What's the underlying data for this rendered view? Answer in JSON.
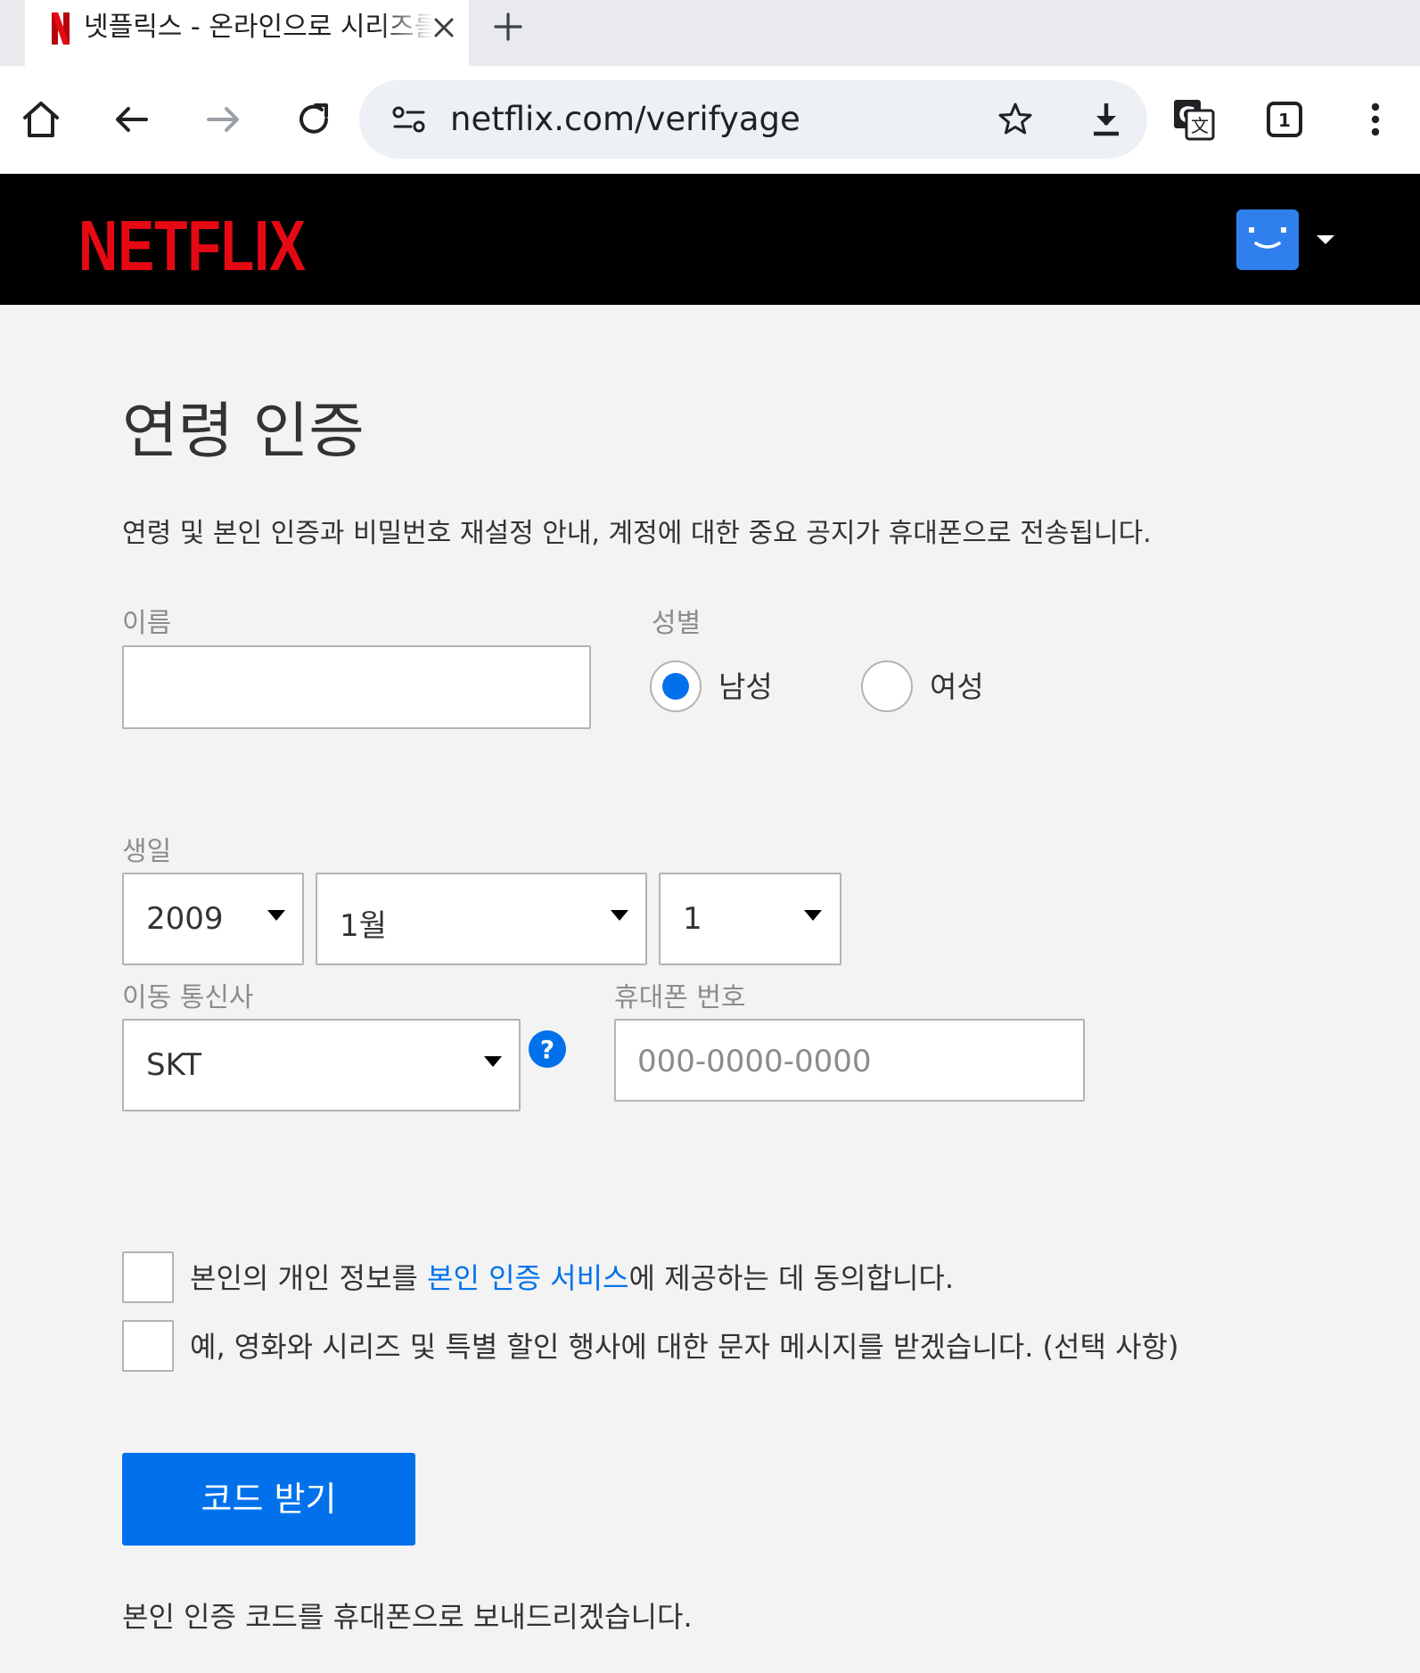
{
  "browser": {
    "tab": {
      "title": "넷플릭스 - 온라인으로 시리즈를 시청하세요",
      "close_icon": "close-icon",
      "favicon_color": "#e50914"
    },
    "new_tab_icon": "plus-icon",
    "toolbar": {
      "icons": [
        "home-icon",
        "back-arrow-icon",
        "forward-arrow-icon",
        "reload-icon",
        "translate-icon",
        "tab-count-icon",
        "more-vert-icon"
      ],
      "tab_count": "1"
    },
    "omnibox": {
      "url": "netflix.com/verifyage",
      "icons": [
        "site-settings-icon",
        "star-icon",
        "download-icon"
      ]
    }
  },
  "header": {
    "logo_text": "NETFLIX",
    "brand_color": "#e50914",
    "avatar_color": "#2f80ed"
  },
  "page": {
    "title": "연령 인증",
    "intro": "연령 및 본인 인증과 비밀번호 재설정 안내, 계정에 대한 중요 공지가 휴대폰으로 전송됩니다.",
    "name": {
      "label": "이름",
      "value": ""
    },
    "gender": {
      "label": "성별",
      "options": [
        {
          "label": "남성",
          "selected": true
        },
        {
          "label": "여성",
          "selected": false
        }
      ]
    },
    "birthday": {
      "label": "생일",
      "year": "2009",
      "month": "1월",
      "day": "1"
    },
    "carrier": {
      "label": "이동 통신사",
      "value": "SKT",
      "help_icon": "question-icon"
    },
    "phone": {
      "label": "휴대폰 번호",
      "placeholder": "000-0000-0000"
    },
    "consent": {
      "prefix": "본인의 개인 정보를 ",
      "link": "본인 인증 서비스",
      "suffix": "에 제공하는 데 동의합니다.",
      "checked": false
    },
    "sms_optin": {
      "text": "예, 영화와 시리즈 및 특별 할인 행사에 대한 문자 메시지를 받겠습니다. (선택 사항)",
      "checked": false
    },
    "submit_label": "코드 받기",
    "footer_note": "본인 인증 코드를 휴대폰으로 보내드리겠습니다.",
    "accent_color": "#0071eb"
  }
}
